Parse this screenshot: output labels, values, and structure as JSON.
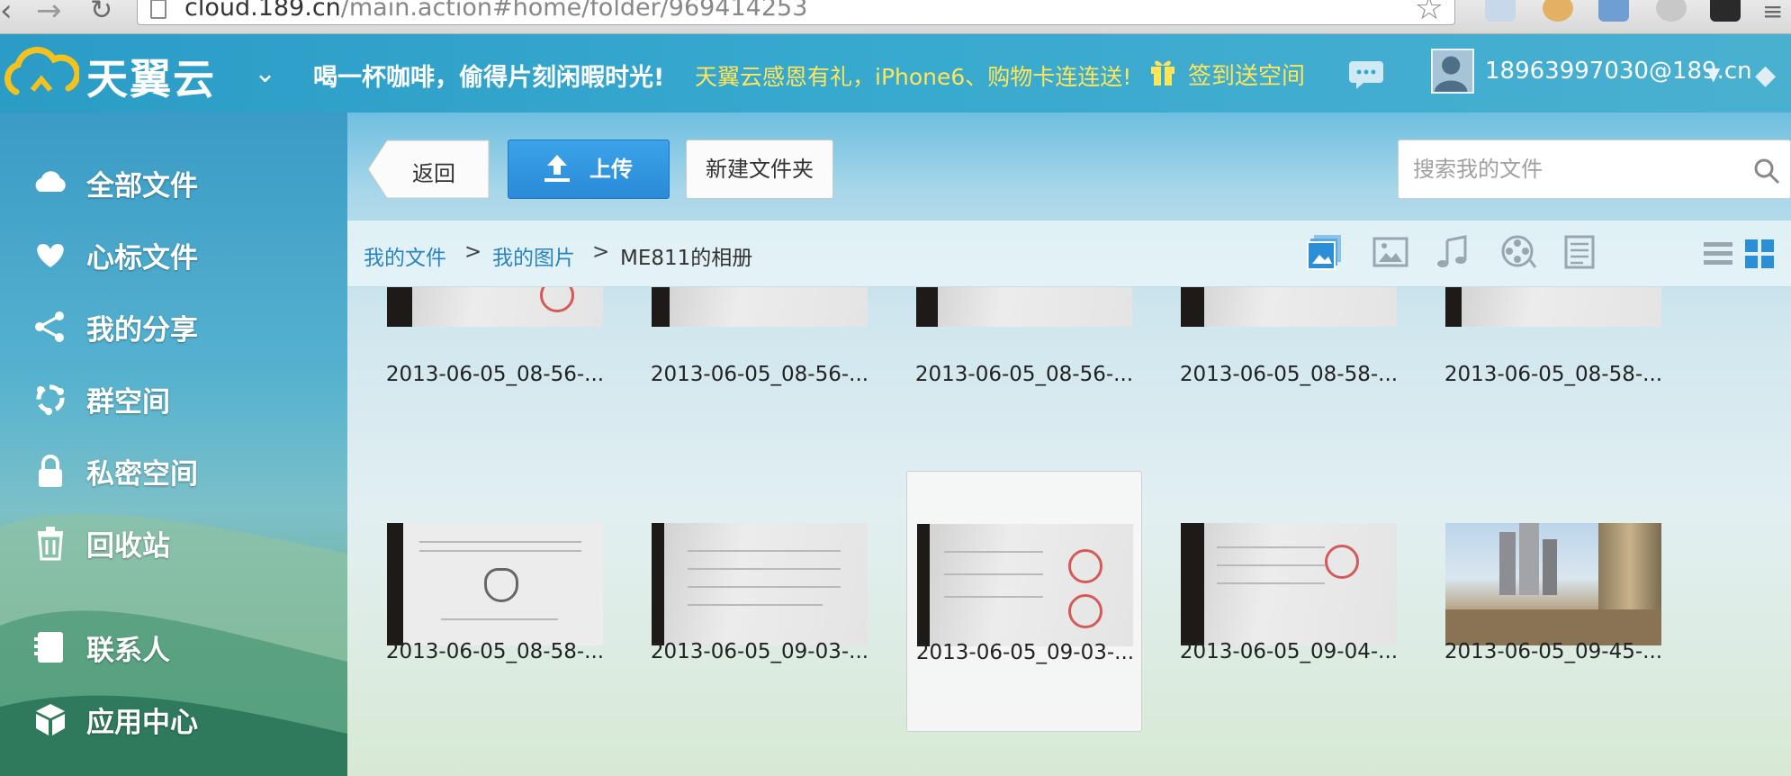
{
  "browser": {
    "url_host": "cloud.189.cn",
    "url_path": "/main.action#home/folder/969414253"
  },
  "header": {
    "brand": "天翼云",
    "slogan": "喝一杯咖啡，偷得片刻闲暇时光!",
    "promo": "天翼云感恩有礼，iPhone6、购物卡连连送!",
    "signin": "签到送空间",
    "username": "18963997030@189.cn"
  },
  "sidebar": {
    "items": [
      {
        "label": "全部文件",
        "icon": "cloud-icon"
      },
      {
        "label": "心标文件",
        "icon": "heart-icon"
      },
      {
        "label": "我的分享",
        "icon": "share-icon"
      },
      {
        "label": "群空间",
        "icon": "group-icon"
      },
      {
        "label": "私密空间",
        "icon": "lock-icon"
      },
      {
        "label": "回收站",
        "icon": "trash-icon"
      },
      {
        "label": "联系人",
        "icon": "contacts-icon"
      },
      {
        "label": "应用中心",
        "icon": "apps-icon"
      }
    ]
  },
  "toolbar": {
    "back": "返回",
    "upload": "上传",
    "new_folder": "新建文件夹",
    "search_placeholder": "搜索我的文件"
  },
  "breadcrumb": {
    "root": "我的文件",
    "parent": "我的图片",
    "current": "ME811的相册",
    "separator": ">"
  },
  "files": [
    {
      "name": "2013-06-05_08-56-..."
    },
    {
      "name": "2013-06-05_08-56-..."
    },
    {
      "name": "2013-06-05_08-56-..."
    },
    {
      "name": "2013-06-05_08-58-..."
    },
    {
      "name": "2013-06-05_08-58-..."
    },
    {
      "name": "2013-06-05_08-58-..."
    },
    {
      "name": "2013-06-05_09-03-..."
    },
    {
      "name": "2013-06-05_09-03-..."
    },
    {
      "name": "2013-06-05_09-04-..."
    },
    {
      "name": "2013-06-05_09-45-..."
    }
  ],
  "colors": {
    "header": "#2b9cc6",
    "promo": "#ffe659",
    "upload_button": "#2a8ad8",
    "link": "#2a83c2"
  }
}
